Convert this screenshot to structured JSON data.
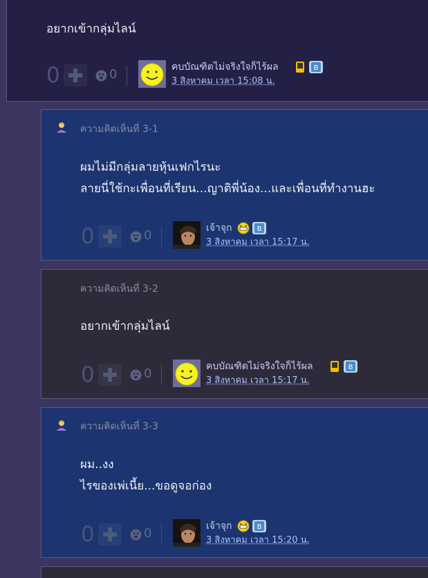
{
  "top_post": {
    "message": "อยากเข้ากลุ่มไลน์",
    "vote_count": "0",
    "emote_count": "0",
    "author": "คบบัณฑิตไม่จริงใจก็ไร้ผล",
    "date": "3 สิงหาคม เวลา 15:08 น."
  },
  "comments": [
    {
      "label": "ความคิดเห็นที่ 3-1",
      "message_lines": [
        "ผมไม่มีกลุ่มลายหุ้นเฟกไรนะ",
        "ลายนี่ใช้กะเพื่อนที่เรียน...ญาติพี่น้อง...และเพื่อนที่ทำงานฮะ"
      ],
      "vote_count": "0",
      "emote_count": "0",
      "author": "เจ้าจุก",
      "date": "3 สิงหาคม เวลา 15:17 น."
    },
    {
      "label": "ความคิดเห็นที่ 3-2",
      "message_lines": [
        "อยากเข้ากลุ่มไลน์"
      ],
      "vote_count": "0",
      "emote_count": "0",
      "author": "คบบัณฑิตไม่จริงใจก็ไร้ผล",
      "date": "3 สิงหาคม เวลา 15:17 น."
    },
    {
      "label": "ความคิดเห็นที่ 3-3",
      "message_lines": [
        "ผม..งง",
        "ไรของเพ่เนี้ย...ขอดูจอก่อง"
      ],
      "vote_count": "0",
      "emote_count": "0",
      "author": "เจ้าจุก",
      "date": "3 สิงหาคม เวลา 15:20 น."
    }
  ],
  "icons": {
    "plus": "plus-icon",
    "emote": "emotion-icon",
    "person": "person-icon",
    "badge_mobile": "mobile-badge-icon",
    "badge_blog": "blog-badge-icon",
    "badge_grin": "grin-badge-icon"
  },
  "colors": {
    "page_bg": "#3b3560",
    "comment_blue": "#1c3570",
    "comment_gray": "#2d2a3a",
    "date_link": "#aac0ff"
  }
}
